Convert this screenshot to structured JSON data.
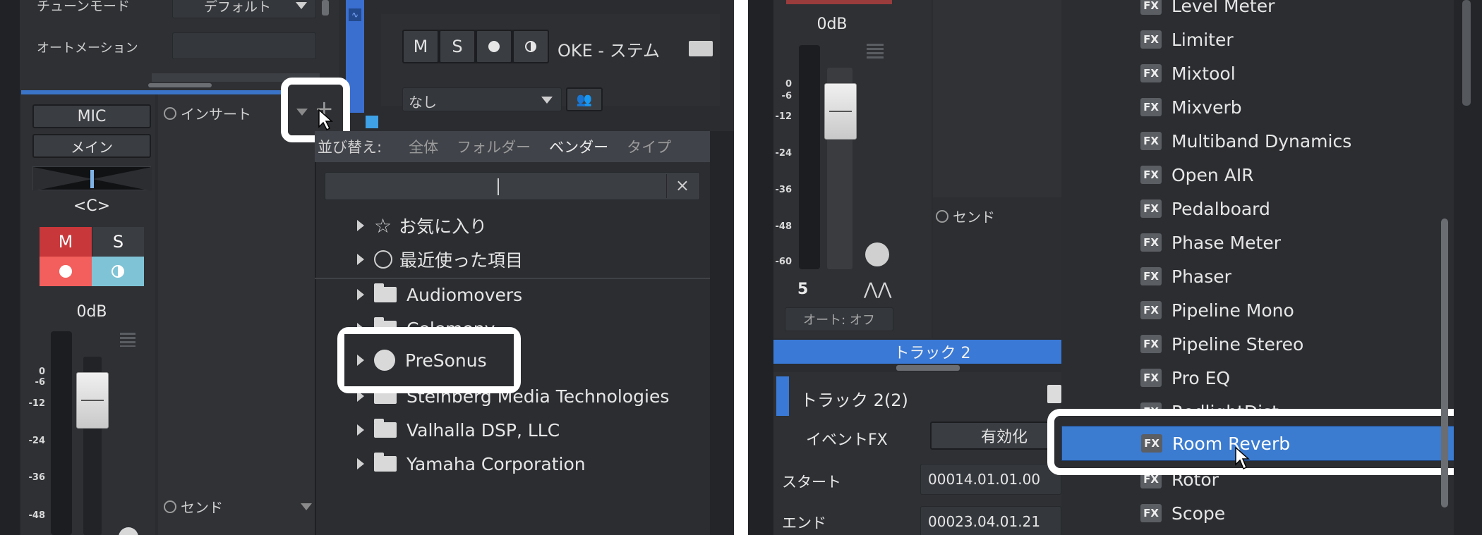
{
  "left": {
    "tune_mode_label": "チューンモード",
    "tune_mode_value": "デフォルト",
    "automation_label": "オートメーション",
    "channel_input": "MIC",
    "channel_output": "メイン",
    "pan_value": "<C>",
    "mute": "M",
    "solo": "S",
    "volume": "0dB",
    "scale": [
      "0",
      "-6",
      "-12",
      "-24",
      "-36",
      "-48"
    ],
    "insert_label": "インサート",
    "send_label": "センド",
    "track_buttons": [
      "M",
      "S"
    ],
    "track_name": "OKE - ステム",
    "preset_value": "なし",
    "sort_label": "並び替え:",
    "sort_tabs": [
      "全体",
      "フォルダー",
      "ベンダー",
      "タイプ"
    ],
    "search_placeholder": "",
    "clear_button": "×",
    "favorites": "お気に入り",
    "recent": "最近使った項目",
    "vendors": [
      "Audiomovers",
      "Celemony",
      "PreSonus",
      "Steinberg Media Technologies",
      "Valhalla DSP, LLC",
      "Yamaha Corporation"
    ]
  },
  "right": {
    "volume": "0dB",
    "scale": [
      "0",
      "-6",
      "-12",
      "-24",
      "-36",
      "-48",
      "-60"
    ],
    "channel_number": "5",
    "auto_label": "オート: オフ",
    "send_label": "センド",
    "track_banner": "トラック 2",
    "track_name": "トラック 2(2)",
    "event_fx_label": "イベントFX",
    "enable_button": "有効化",
    "start_label": "スタート",
    "start_value": "00014.01.01.00",
    "end_label": "エンド",
    "end_value": "00023.04.01.21",
    "fx_tag": "FX",
    "fx_items": [
      "Level Meter",
      "Limiter",
      "Mixtool",
      "Mixverb",
      "Multiband Dynamics",
      "Open AIR",
      "Pedalboard",
      "Phase Meter",
      "Phaser",
      "Pipeline Mono",
      "Pipeline Stereo",
      "Pro EQ",
      "RedlightDist",
      "Room Reverb",
      "Rotor",
      "Scope"
    ],
    "selected_fx": "Room Reverb"
  },
  "colors": {
    "bg_dark": "#2b2d31",
    "mute_red": "#c8373a",
    "solo_blue": "#7fc4d6",
    "accent_blue": "#3a74c9",
    "selection_blue": "#3b7bd0",
    "highlight_frame": "#ffffff"
  }
}
